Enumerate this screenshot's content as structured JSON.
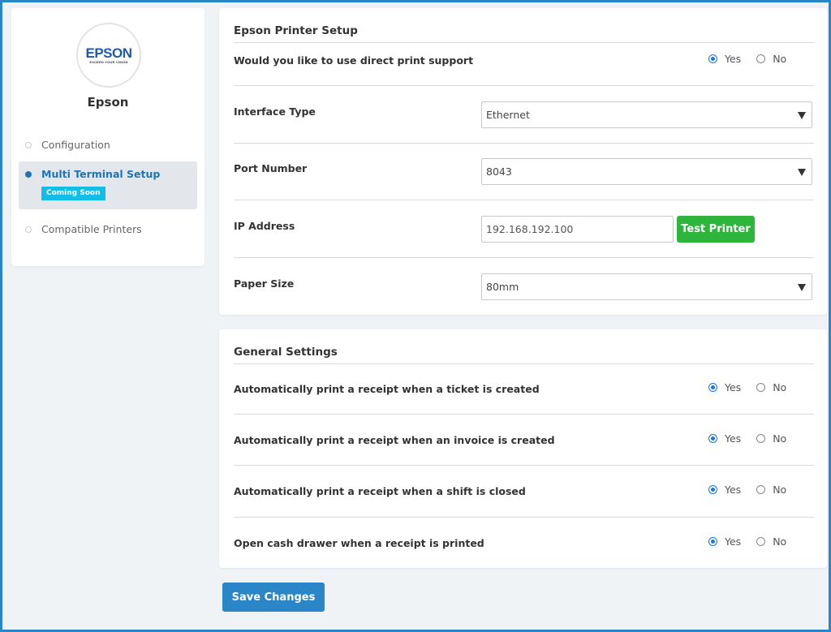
{
  "sidebar": {
    "logo": {
      "word": "EPSON",
      "tagline": "EXCEED YOUR VISION"
    },
    "brand_name": "Epson",
    "items": [
      {
        "label": "Configuration",
        "active": false
      },
      {
        "label": "Multi Terminal Setup",
        "active": true,
        "badge": "Coming Soon"
      },
      {
        "label": "Compatible Printers",
        "active": false
      }
    ]
  },
  "printer_setup": {
    "title": "Epson Printer Setup",
    "direct_print": {
      "label": "Would you like to use direct print support",
      "yes": "Yes",
      "no": "No",
      "selected": "Yes"
    },
    "interface_type": {
      "label": "Interface Type",
      "value": "Ethernet"
    },
    "port_number": {
      "label": "Port Number",
      "value": "8043"
    },
    "ip_address": {
      "label": "IP Address",
      "value": "192.168.192.100",
      "test_button": "Test Printer"
    },
    "paper_size": {
      "label": "Paper Size",
      "value": "80mm"
    }
  },
  "general_settings": {
    "title": "General Settings",
    "rows": [
      {
        "label": "Automatically print a receipt when a ticket is created",
        "yes": "Yes",
        "no": "No",
        "selected": "Yes"
      },
      {
        "label": "Automatically print a receipt when an invoice is created",
        "yes": "Yes",
        "no": "No",
        "selected": "Yes"
      },
      {
        "label": "Automatically print a receipt when a shift is closed",
        "yes": "Yes",
        "no": "No",
        "selected": "Yes"
      },
      {
        "label": "Open cash drawer when a receipt is printed",
        "yes": "Yes",
        "no": "No",
        "selected": "Yes"
      }
    ]
  },
  "footer": {
    "save_label": "Save Changes"
  },
  "colors": {
    "accent": "#2b86c8",
    "active_nav": "#1f74b3",
    "badge": "#13bee6",
    "test_button": "#2db53c",
    "radio": "#1a73e8"
  }
}
